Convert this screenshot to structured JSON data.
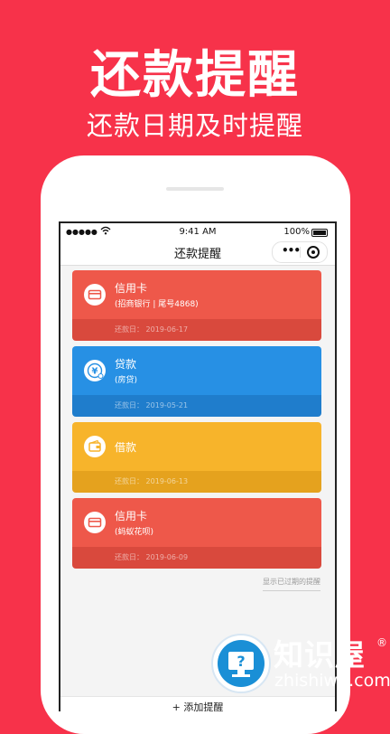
{
  "hero": {
    "title": "还款提醒",
    "subtitle": "还款日期及时提醒"
  },
  "status_bar": {
    "signal": "●●●●●",
    "time": "9:41 AM",
    "battery": "100%"
  },
  "nav": {
    "title": "还款提醒",
    "more": "•••"
  },
  "cards": [
    {
      "title": "信用卡",
      "subtitle": "(招商银行 | 尾号4868)",
      "date_label": "还款日：",
      "date": "2019-06-17",
      "icon": "credit-card-icon",
      "color_top": "#ee584a",
      "color_bottom": "#d9493d"
    },
    {
      "title": "贷款",
      "subtitle": "(房贷)",
      "date_label": "还款日：",
      "date": "2019-05-21",
      "icon": "yuan-loan-icon",
      "color_top": "#2790e4",
      "color_bottom": "#1f7dcc"
    },
    {
      "title": "借款",
      "subtitle": "",
      "date_label": "还款日：",
      "date": "2019-06-13",
      "icon": "wallet-icon",
      "color_top": "#f7b42b",
      "color_bottom": "#e5a21e"
    },
    {
      "title": "信用卡",
      "subtitle": "(蚂蚁花呗)",
      "date_label": "还款日：",
      "date": "2019-06-09",
      "icon": "credit-card-icon",
      "color_top": "#ee584a",
      "color_bottom": "#d9493d"
    }
  ],
  "show_expired": "显示已过期的提醒",
  "add_button": "+ 添加提醒",
  "watermark": {
    "name": "知识屋",
    "reg": "®",
    "url": "zhishiwu.com"
  },
  "colors": {
    "background": "#f7324a",
    "accent": "#2790e4"
  }
}
